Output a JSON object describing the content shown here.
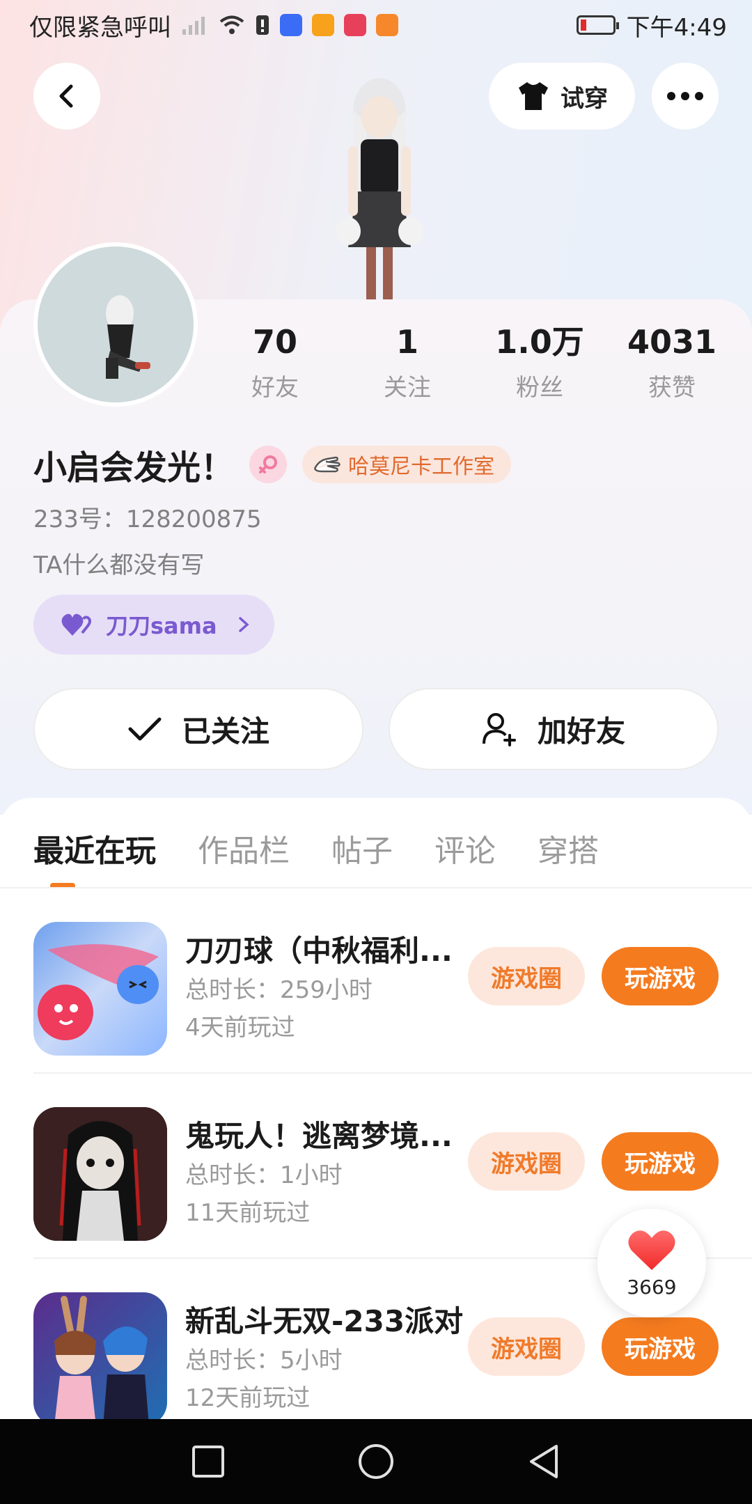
{
  "status_bar": {
    "left_text": "仅限紧急呼叫",
    "time": "下午4:49"
  },
  "header": {
    "tryon_label": "试穿"
  },
  "profile": {
    "name": "小启会发光！",
    "studio_badge": "哈莫尼卡工作室",
    "account_id": "233号：128200875",
    "bio": "TA什么都没有写",
    "partner": "刀刀sama",
    "stats": [
      {
        "value": "70",
        "label": "好友"
      },
      {
        "value": "1",
        "label": "关注"
      },
      {
        "value": "1.0万",
        "label": "粉丝"
      },
      {
        "value": "4031",
        "label": "获赞"
      }
    ],
    "follow_label": "已关注",
    "add_friend_label": "加好友"
  },
  "tabs": [
    {
      "label": "最近在玩",
      "active": true
    },
    {
      "label": "作品栏",
      "active": false
    },
    {
      "label": "帖子",
      "active": false
    },
    {
      "label": "评论",
      "active": false
    },
    {
      "label": "穿搭",
      "active": false
    }
  ],
  "games": [
    {
      "title": "刀刃球（中秋福利...",
      "duration": "总时长：259小时",
      "last_played": "4天前玩过",
      "circle_label": "游戏圈",
      "play_label": "玩游戏"
    },
    {
      "title": "鬼玩人！逃离梦境...",
      "duration": "总时长：1小时",
      "last_played": "11天前玩过",
      "circle_label": "游戏圈",
      "play_label": "玩游戏"
    },
    {
      "title": "新乱斗无双-233派对",
      "duration": "总时长：5小时",
      "last_played": "12天前玩过",
      "circle_label": "游戏圈",
      "play_label": "玩游戏"
    }
  ],
  "like_float": {
    "count": "3669",
    "icon": "heart-icon"
  },
  "colors": {
    "accent": "#f57b1f",
    "accent_soft": "#fde7dc",
    "partner_bg": "#e6def7",
    "partner_text": "#7a5ad0"
  }
}
